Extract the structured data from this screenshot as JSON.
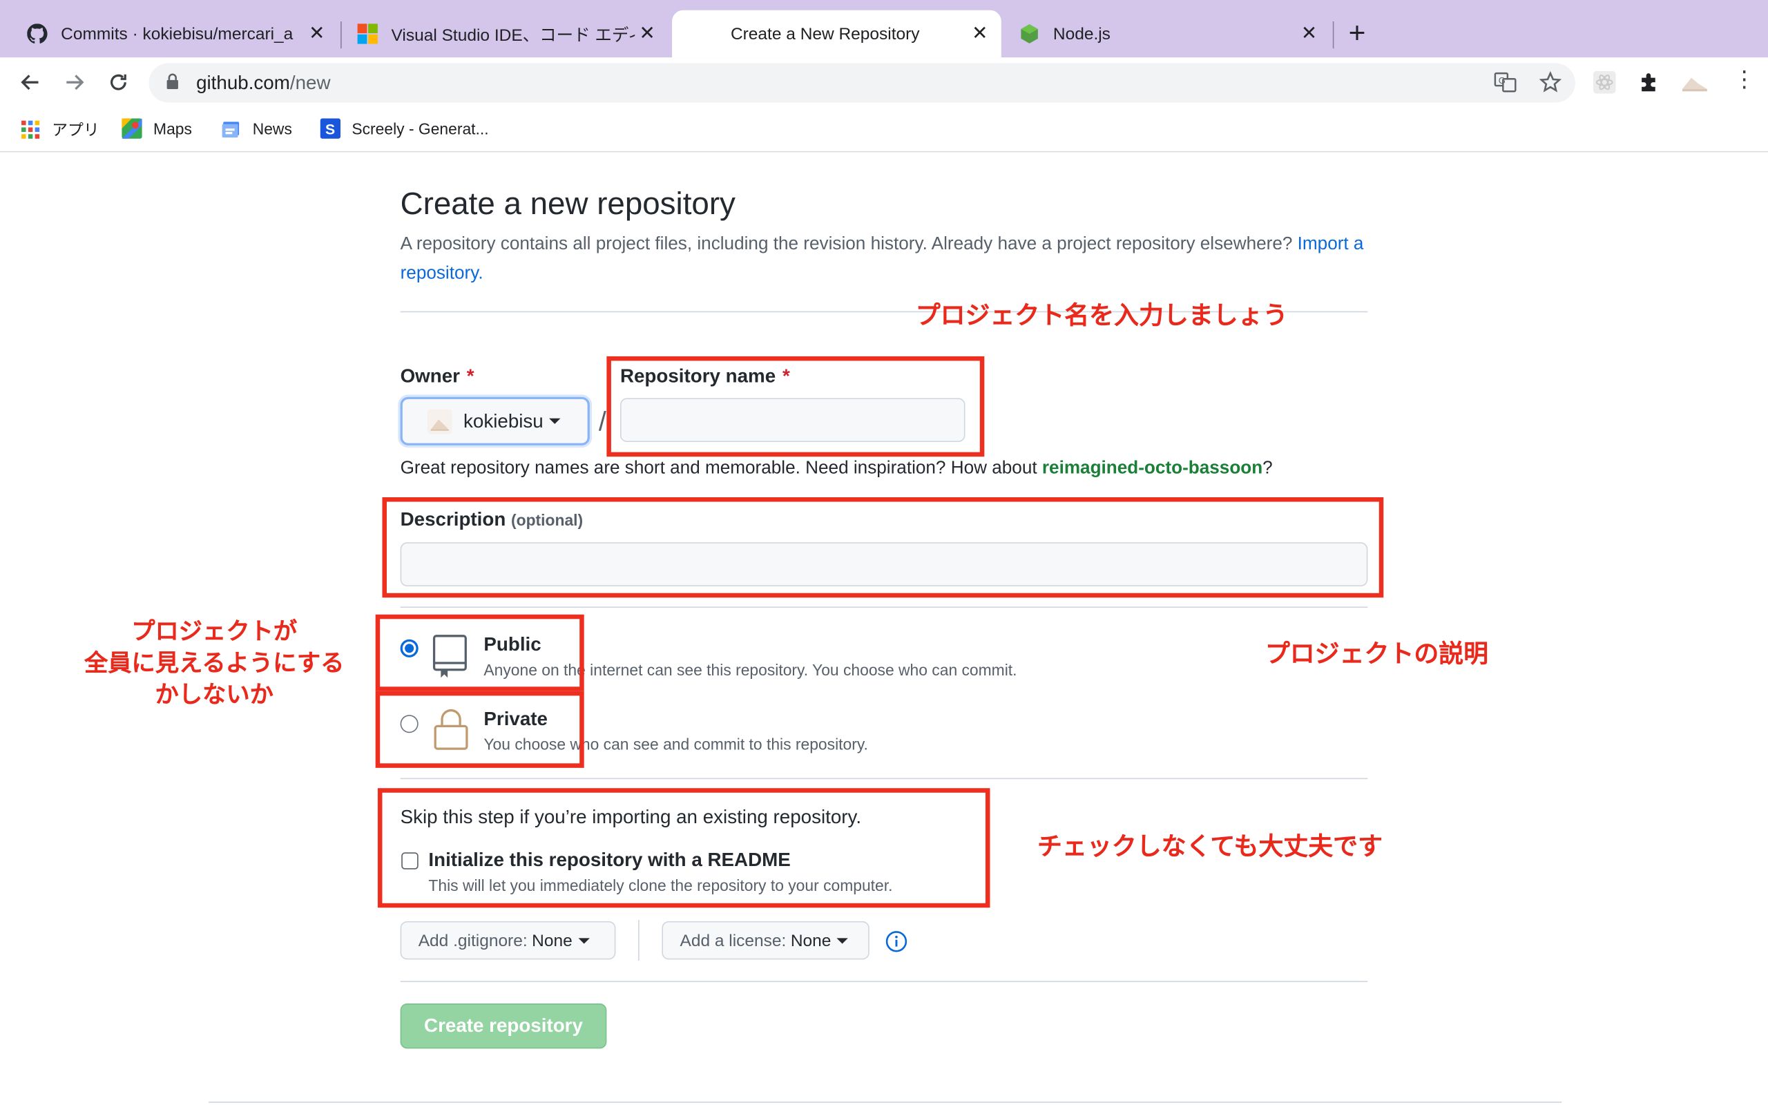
{
  "browser": {
    "tabs": [
      {
        "title": "Commits · kokiebisu/mercari_a",
        "icon": "github-icon",
        "active": false
      },
      {
        "title": "Visual Studio IDE、コード エディ",
        "icon": "microsoft-icon",
        "active": false
      },
      {
        "title": "Create a New Repository",
        "icon": "",
        "active": true
      },
      {
        "title": "Node.js",
        "icon": "nodejs-icon",
        "active": false
      }
    ],
    "url_host": "github.com",
    "url_path": "/new",
    "bookmarks": [
      {
        "label": "アプリ",
        "icon": "apps-grid-icon"
      },
      {
        "label": "Maps",
        "icon": "maps-icon"
      },
      {
        "label": "News",
        "icon": "news-icon"
      },
      {
        "label": "Screely - Generat...",
        "icon": "screely-icon"
      }
    ]
  },
  "page": {
    "title": "Create a new repository",
    "intro_text": "A repository contains all project files, including the revision history. Already have a project repository elsewhere?",
    "import_link": "Import a repository.",
    "owner_label": "Owner",
    "owner_value": "kokiebisu",
    "required_mark": "*",
    "slash": "/",
    "repo_name_label": "Repository name",
    "repo_name_value": "",
    "hint_text": "Great repository names are short and memorable. Need inspiration? How about",
    "hint_suggestion": "reimagined-octo-bassoon",
    "hint_end": "?",
    "description_label": "Description",
    "description_optional": "(optional)",
    "description_value": "",
    "public_title": "Public",
    "public_desc": "Anyone on the internet can see this repository. You choose who can commit.",
    "private_title": "Private",
    "private_desc": "You choose who can see and commit to this repository.",
    "visibility_selected": "public",
    "skip_text": "Skip this step if you’re importing an existing repository.",
    "readme_title": "Initialize this repository with a README",
    "readme_desc": "This will let you immediately clone the repository to your computer.",
    "readme_checked": false,
    "gitignore_label": "Add .gitignore:",
    "gitignore_value": "None",
    "license_label": "Add a license:",
    "license_value": "None",
    "create_button": "Create repository"
  },
  "annotations": {
    "project_name": "プロジェクト名を入力しましょう",
    "visibility_line1": "プロジェクトが",
    "visibility_line2": "全員に見えるようにする",
    "visibility_line3": "かしないか",
    "description": "プロジェクトの説明",
    "readme": "チェックしなくても大丈夫です",
    "color": "#e8291c"
  }
}
